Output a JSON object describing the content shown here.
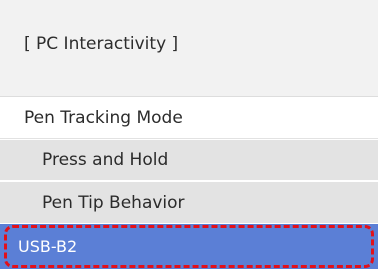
{
  "header": {
    "title": "[ PC Interactivity ]"
  },
  "menu": {
    "section_label": "Pen Tracking Mode",
    "items": [
      {
        "label": "Press and Hold"
      },
      {
        "label": "Pen Tip Behavior"
      }
    ],
    "selected": {
      "label": "USB-B2"
    }
  },
  "colors": {
    "header_bg": "#f2f2f2",
    "submenu_bg": "#e3e3e3",
    "selected_bg": "#5b7fd6",
    "focus_ring": "#e2101a"
  }
}
